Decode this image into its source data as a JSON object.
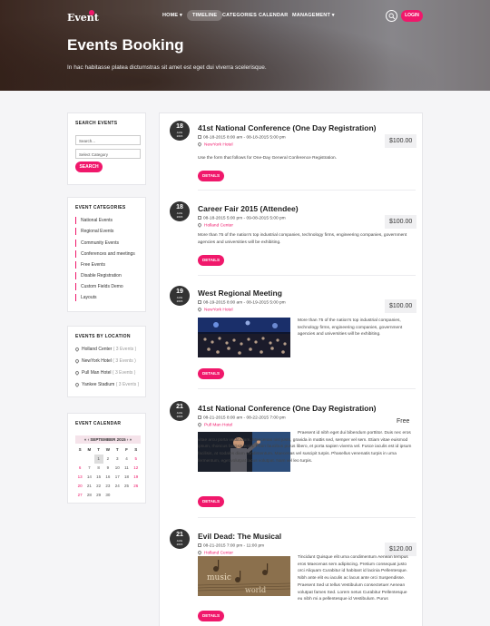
{
  "header": {
    "logo": "Event",
    "nav": {
      "home": "HOME ▾",
      "timeline": "TIMELINE",
      "categories": "CATEGORIES",
      "calendar": "CALENDAR",
      "management": "MANAGEMENT ▾"
    },
    "login": "LOGIN",
    "title": "Events Booking",
    "subtitle": "In hac habitasse platea dictumstras sit amet est eget dui viverra scelerisque."
  },
  "search": {
    "heading": "SEARCH EVENTS",
    "input_value": "Search...",
    "category_value": "Select Category",
    "button": "SEARCH"
  },
  "categories": {
    "heading": "EVENT CATEGORIES",
    "items": [
      "National Events",
      "Regional Events",
      "Community Events",
      "Conferences and meetings",
      "Free Events",
      "Disable Registration",
      "Custom Fields Demo",
      "Layouts"
    ]
  },
  "locations": {
    "heading": "EVENTS BY LOCATION",
    "items": [
      {
        "name": "Holland Center",
        "count": "( 3 Events )"
      },
      {
        "name": "NewYork Hotel",
        "count": "( 3 Events )"
      },
      {
        "name": "Pull Man Hotel",
        "count": "( 3 Events )"
      },
      {
        "name": "Yankee Stadium",
        "count": "( 3 Events )"
      }
    ]
  },
  "calendar": {
    "heading": "EVENT CALENDAR",
    "month": "«   ‹   SEPTEMBER  2015   ›   »",
    "days": [
      "S",
      "M",
      "T",
      "W",
      "T",
      "F",
      "S"
    ],
    "weeks": [
      [
        "",
        "",
        "1",
        "2",
        "3",
        "4",
        "5"
      ],
      [
        "6",
        "7",
        "8",
        "9",
        "10",
        "11",
        "12"
      ],
      [
        "13",
        "14",
        "15",
        "16",
        "17",
        "18",
        "19"
      ],
      [
        "20",
        "21",
        "22",
        "23",
        "24",
        "25",
        "26"
      ],
      [
        "27",
        "28",
        "29",
        "30",
        "",
        "",
        ""
      ]
    ],
    "highlight_color": "#f0186b"
  },
  "events": [
    {
      "day": "18",
      "month": "AUG",
      "year": "2015",
      "title": "41st National Conference (One Day Registration)",
      "time": "08-18-2015 8:00 am - 08-18-2015 5:00 pm",
      "venue": "NewYork Hotel",
      "price": "$100.00",
      "desc": "Use the form that follows for One-Day General Conference Registration.",
      "details": "DETAILS"
    },
    {
      "day": "18",
      "month": "AUG",
      "year": "2015",
      "title": "Career Fair 2015 (Attendee)",
      "time": "08-18-2015 5:00 pm - 09-08-2015 5:00 pm",
      "venue": "Holland Center",
      "price": "$100.00",
      "desc": "More than 75 of the nation's top industrial companies, technology firms, engineering companies, government agencies and universities will be exhibiting.",
      "details": "DETAILS"
    },
    {
      "day": "19",
      "month": "AUG",
      "year": "2015",
      "title": "West Regional Meeting",
      "time": "08-19-2015 8:00 am - 08-19-2015 5:00 pm",
      "venue": "NewYork Hotel",
      "price": "$100.00",
      "desc": "More than 75 of the nation's top industrial companies, technology firms, engineering companies, government agencies and universities will be exhibiting.",
      "details": "DETAILS"
    },
    {
      "day": "21",
      "month": "AUG",
      "year": "2015",
      "title": "41st National Conference (One Day Registration)",
      "time": "08-21-2015 8:00 am - 08-22-2015 7:00 pm",
      "venue": "Pull Man Hotel",
      "price": "Free",
      "desc": "Praesent id nibh eget dui bibendum porttitor. Duis nec eros vitae arcu porta vestibulum. Maecenas nisl justo, gravida in mattis sed, semper vel sem. Etiam vitae euismod ipsum, rhoncus facilisis enim. Proin faucibus purus libero, et porta sapien viverra vel. Fusce iaculis est id ipsum facilisis, at sodales diam condimentum. Maecenas vel suscipit turpis. Phasellus venenatis turpis in urna fermentum, eget volutpat lacus volutpat. Nam vel leo turpis.",
      "details": "DETAILS"
    },
    {
      "day": "21",
      "month": "AUG",
      "year": "2015",
      "title": "Evil Dead: The Musical",
      "time": "08-21-2015 7:00 pm - 11:00 pm",
      "venue": "Holland Center",
      "price": "$120.00",
      "desc": "Tincidunt Quisque elit urna condimentum Aenean tempus eros Maecenas sem adipiscing. Pretium consequat justo orci Aliquam Curabitur id habitant id lacinia Pellentesque. Nibh ante elit eu iaculis ac lacus ante orci Suspendisse. Praesent Sed ut tellus Vestibulum consectetuer Aenean volutpat fames Sed. Lorem netus Curabitur Pellentesque eu nibh mi a pellentesque id Vestibulum. Purus",
      "details": "DETAILS"
    }
  ]
}
